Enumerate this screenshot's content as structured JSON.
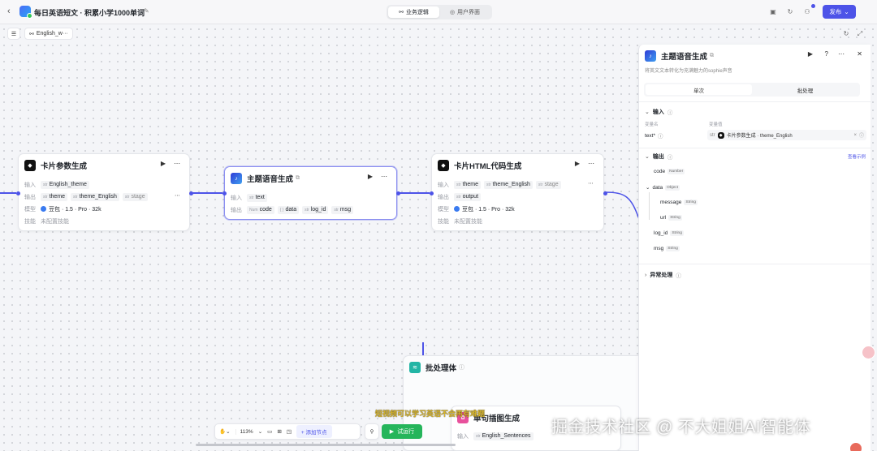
{
  "header": {
    "title": "每日英语短文 · 积累小学1000单词",
    "tabs": [
      {
        "label": "业务逻辑",
        "active": true
      },
      {
        "label": "用户界面",
        "active": false
      }
    ],
    "publish_label": "发布"
  },
  "canvas": {
    "workflow_tab": "English_w···"
  },
  "nodes": {
    "card_params": {
      "title": "卡片参数生成",
      "input_label": "输入",
      "input_chip": "English_theme",
      "output_label": "输出",
      "output_chips": [
        "theme",
        "theme_English",
        "stage"
      ],
      "model_label": "模型",
      "model_value": "豆包 · 1.5 · Pro · 32k",
      "skill_label": "技能",
      "skill_value": "未配置技能"
    },
    "theme_audio": {
      "title": "主题语音生成",
      "input_label": "输入",
      "input_chip": "text",
      "output_label": "输出",
      "output_chips": [
        "code",
        "data",
        "log_id",
        "msg"
      ]
    },
    "card_html": {
      "title": "卡片HTML代码生成",
      "input_label": "输入",
      "input_chips": [
        "theme",
        "theme_English",
        "stage"
      ],
      "output_label": "输出",
      "output_chip": "output",
      "model_label": "模型",
      "model_value": "豆包 · 1.5 · Pro · 32k",
      "skill_label": "技能",
      "skill_value": "未配置技能"
    },
    "batch": {
      "title": "批处理体"
    },
    "sentence_gen": {
      "title": "单句插图生成",
      "input_label": "输入",
      "input_chip": "English_Sentences"
    }
  },
  "panel": {
    "title": "主题语音生成",
    "description": "将英文文本转化为充满魅力的sophie声音",
    "tabs": [
      "单次",
      "批处理"
    ],
    "input_section": "输入",
    "var_name_label": "变量名",
    "var_value_label": "变量值",
    "input_var": "text*",
    "input_type": "str",
    "input_ref": "卡片参数生成 · theme_English",
    "output_section": "输出",
    "view_example": "查看示例",
    "outputs": [
      {
        "name": "code",
        "type": "Number"
      },
      {
        "name": "data",
        "type": "Object"
      },
      {
        "name": "message",
        "type": "String"
      },
      {
        "name": "url",
        "type": "String"
      },
      {
        "name": "log_id",
        "type": "String"
      },
      {
        "name": "msg",
        "type": "String"
      }
    ],
    "exception_section": "异常处理"
  },
  "toolbar": {
    "zoom": "113%",
    "add_node": "添加节点",
    "run": "试运行"
  },
  "overlay": {
    "subtitle": "短视频可以学习英语不会再有难题",
    "watermark": "掘金技术社区 @ 不大姐姐AI智能体"
  },
  "colors": {
    "accent": "#4d53e8",
    "run": "#25b55b",
    "batch": "#22b5a5"
  }
}
